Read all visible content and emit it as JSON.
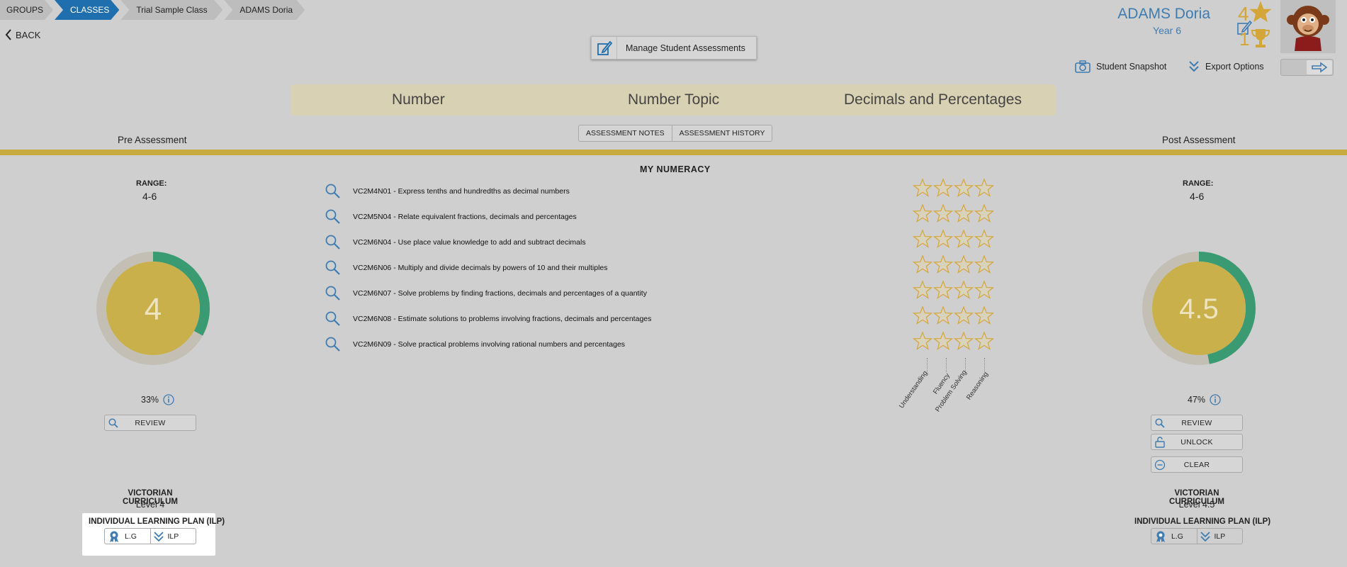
{
  "breadcrumb": [
    "GROUPS",
    "CLASSES",
    "Trial Sample Class",
    "ADAMS Doria"
  ],
  "back_label": "BACK",
  "manage_label": "Manage Student Assessments",
  "student": {
    "name": "ADAMS Doria",
    "year": "Year 6",
    "stars": "4",
    "trophies": "1"
  },
  "snapshot_label": "Student Snapshot",
  "export_label": "Export Options",
  "topic": {
    "strand": "Number",
    "topic": "Number Topic",
    "subtopic": "Decimals and Percentages"
  },
  "tabs": {
    "notes": "ASSESSMENT NOTES",
    "history": "ASSESSMENT HISTORY"
  },
  "section_title": "MY NUMERACY",
  "pre": {
    "title": "Pre Assessment",
    "range_label": "RANGE:",
    "range": "4-6",
    "score": "4",
    "percent": "33%",
    "progress": 0.33,
    "review": "REVIEW",
    "curriculum_label": "VICTORIAN CURRICULUM",
    "level": "Level 4",
    "ilp_label": "INDIVIDUAL LEARNING PLAN (ILP)",
    "lg": "L.G",
    "ilp": "ILP"
  },
  "post": {
    "title": "Post Assessment",
    "range_label": "RANGE:",
    "range": "4-6",
    "score": "4.5",
    "percent": "47%",
    "progress": 0.47,
    "review": "REVIEW",
    "unlock": "UNLOCK",
    "clear": "CLEAR",
    "curriculum_label": "VICTORIAN CURRICULUM",
    "level": "Level 4.5",
    "ilp_label": "INDIVIDUAL LEARNING PLAN (ILP)",
    "lg": "L.G",
    "ilp": "ILP"
  },
  "outcomes": [
    "VC2M4N01 - Express tenths and hundredths as decimal numbers",
    "VC2M5N04 - Relate equivalent fractions, decimals and percentages",
    "VC2M6N04 - Use place value knowledge to add and subtract decimals",
    "VC2M6N06 - Multiply and divide decimals by powers of 10 and their multiples",
    "VC2M6N07 - Solve problems by finding fractions, decimals and percentages of a quantity",
    "VC2M6N08 - Estimate solutions to problems involving fractions, decimals and percentages",
    "VC2M6N09 - Solve practical problems involving rational numbers and percentages"
  ],
  "proficiencies": [
    "Understanding",
    "Fluency",
    "Problem Solving",
    "Reasoning"
  ],
  "colors": {
    "accent": "#1f6fae",
    "gold": "#c9aa3e",
    "donut_fill": "#c9b04a",
    "donut_progress": "#3a9a72",
    "donut_track": "#c4bfb5",
    "star": "#d4a63a"
  }
}
